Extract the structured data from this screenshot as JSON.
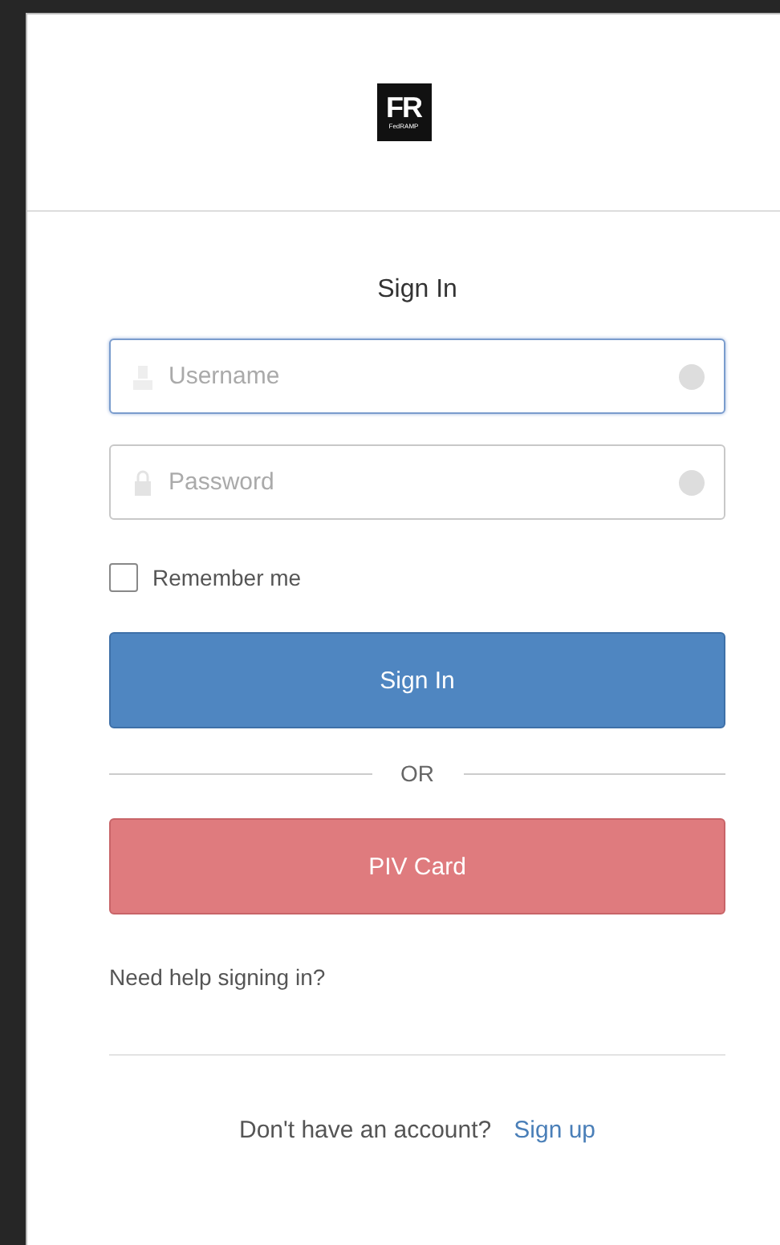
{
  "logo": {
    "mark": "FR",
    "caption": "FedRAMP"
  },
  "title": "Sign In",
  "fields": [
    {
      "kind": "user",
      "placeholder": "Username",
      "focused": true
    },
    {
      "kind": "lock",
      "placeholder": "Password",
      "focused": false
    }
  ],
  "remember": {
    "label": "Remember me",
    "checked": false
  },
  "sign_in_button": "Sign In",
  "divider_text": "OR",
  "piv_button": "PIV Card",
  "help_link": "Need help signing in?",
  "signup": {
    "prompt": "Don't have an account?",
    "link": "Sign up"
  }
}
